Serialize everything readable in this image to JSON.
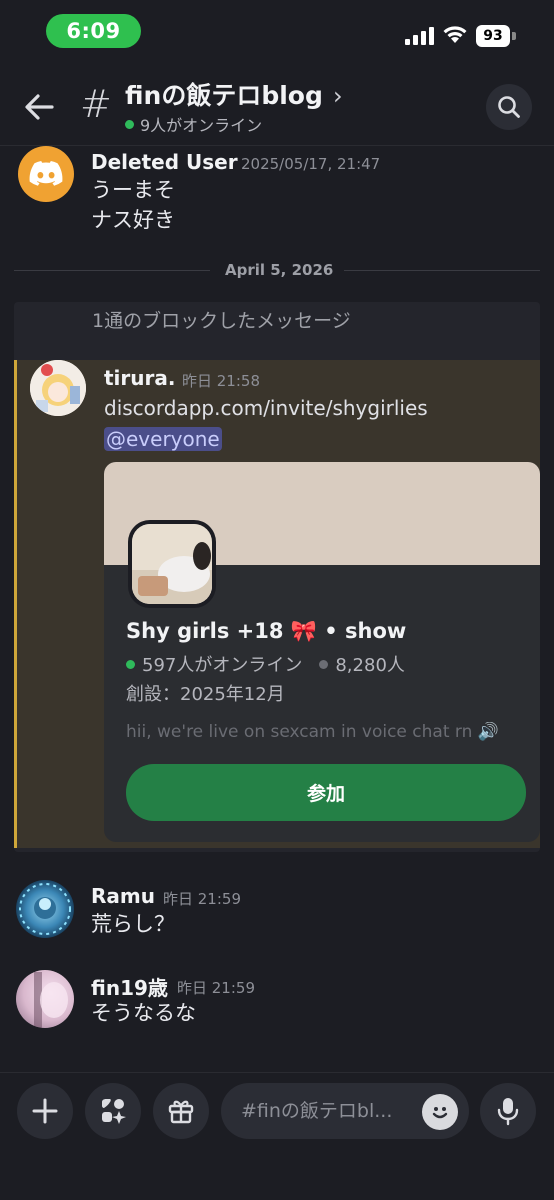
{
  "status_bar": {
    "time": "6:09",
    "battery": "93"
  },
  "header": {
    "channel_prefix": "#",
    "channel_name": "finの飯テロblog",
    "chevron": "›",
    "online": "9人がオンライン",
    "icons": {
      "back": "back-arrow-icon",
      "search": "search-icon"
    }
  },
  "messages": [
    {
      "author": "Deleted User",
      "timestamp": "2025/05/17, 21:47",
      "lines": [
        "うーまそ",
        "ナス好き"
      ],
      "avatar": "discord-logo-icon"
    }
  ],
  "date_divider": "April 5, 2026",
  "blocked": {
    "label": "1通のブロックしたメッセージ",
    "message": {
      "author": "tirura.",
      "timestamp": "昨日 21:58",
      "link": "discordapp.com/invite/shygirlies",
      "mention": "@everyone",
      "invite": {
        "server_name": "Shy girls +18 🎀 • show",
        "online": "597人がオンライン",
        "members": "8,280人",
        "founded": "創設：2025年12月",
        "description": "hii, we're live on sexcam in voice chat rn 🔊",
        "join_label": "参加"
      }
    }
  },
  "later_messages": [
    {
      "author": "Ramu",
      "timestamp": "昨日 21:59",
      "text": "荒らし？"
    },
    {
      "author": "fin19歳",
      "timestamp": "昨日 21:59",
      "text": "そうなるな"
    }
  ],
  "composer": {
    "placeholder": "#finの飯テロbl...",
    "icons": [
      "plus-icon",
      "apps-icon",
      "gift-icon",
      "emoji-icon",
      "microphone-icon"
    ]
  },
  "colors": {
    "background": "#1c1d23",
    "online_green": "#2fba5b",
    "join_button": "#248046",
    "mention_bg": "#4b4e8a",
    "highlight_bar": "#cfa73a"
  }
}
